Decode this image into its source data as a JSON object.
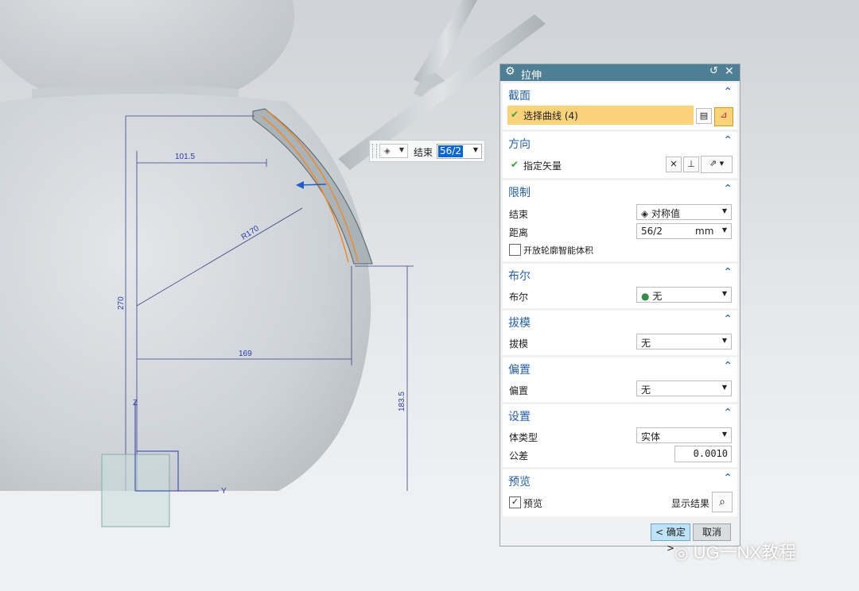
{
  "float_box": {
    "label": "结束",
    "value": "56/2"
  },
  "dims": {
    "d1": "101.5",
    "d2": "R170",
    "d3": "270",
    "d4": "169",
    "d5": "183.5",
    "axis_z": "Z",
    "axis_y": "Y"
  },
  "dialog": {
    "title": "拉伸",
    "sections": {
      "section": {
        "title": "截面",
        "select_curve": "选择曲线 (4)"
      },
      "direction": {
        "title": "方向",
        "vector": "指定矢量"
      },
      "limits": {
        "title": "限制",
        "end_label": "结束",
        "end_value": "对称值",
        "distance_label": "距离",
        "distance_value": "56/2",
        "distance_unit": "mm",
        "open_profile": "开放轮廓智能体积"
      },
      "boolean": {
        "title": "布尔",
        "label": "布尔",
        "value": "无"
      },
      "draft": {
        "title": "拔模",
        "label": "拔模",
        "value": "无"
      },
      "offset": {
        "title": "偏置",
        "label": "偏置",
        "value": "无"
      },
      "settings": {
        "title": "设置",
        "body_type_label": "体类型",
        "body_type_value": "实体",
        "tolerance_label": "公差",
        "tolerance_value": "0.0010"
      },
      "preview": {
        "title": "预览",
        "preview_label": "预览",
        "show_result": "显示结果"
      }
    },
    "ok": "< 确定 >",
    "cancel": "取消"
  },
  "watermark": "UG一NX教程",
  "colors": {
    "titlebar": "#4f7f94",
    "highlight": "#f9d27a",
    "section_title": "#2560a8",
    "dimension": "#2b3aa8",
    "curve": "#f08a2a"
  }
}
